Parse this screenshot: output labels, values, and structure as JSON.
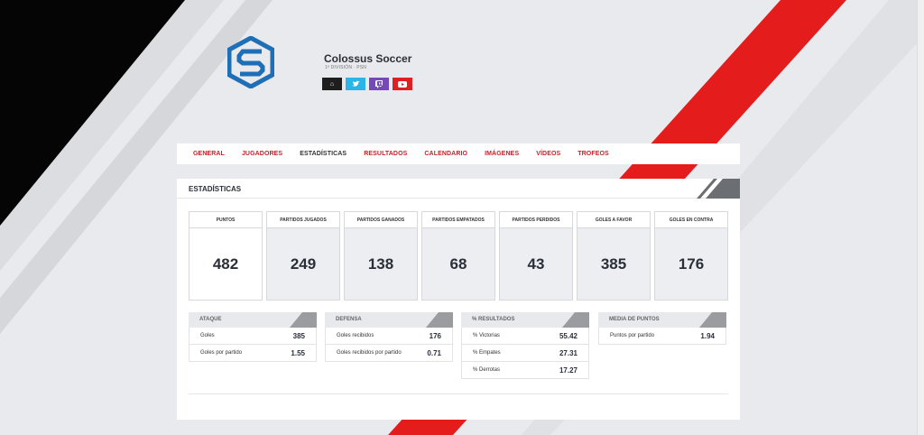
{
  "team": {
    "name": "Colossus Soccer",
    "subtitle": "1ª DIVISIÓN · PSN"
  },
  "social": {
    "home": "home-icon",
    "twitter": "twitter-icon",
    "twitch": "twitch-icon",
    "youtube": "youtube-icon"
  },
  "nav": {
    "items": [
      "GENERAL",
      "JUGADORES",
      "ESTADÍSTICAS",
      "RESULTADOS",
      "CALENDARIO",
      "IMÁGENES",
      "VÍDEOS",
      "TROFEOS"
    ],
    "active": "ESTADÍSTICAS"
  },
  "panel": {
    "title": "ESTADÍSTICAS"
  },
  "stats": [
    {
      "label": "PUNTOS",
      "value": "482"
    },
    {
      "label": "PARTIDOS JUGADOS",
      "value": "249"
    },
    {
      "label": "PARTIDOS GANADOS",
      "value": "138"
    },
    {
      "label": "PARTIDOS EMPATADOS",
      "value": "68"
    },
    {
      "label": "PARTIDOS PERDIDOS",
      "value": "43"
    },
    {
      "label": "GOLES A FAVOR",
      "value": "385"
    },
    {
      "label": "GOLES EN CONTRA",
      "value": "176"
    }
  ],
  "ataque": {
    "title": "ATAQUE",
    "rows": [
      {
        "label": "Goles",
        "value": "385"
      },
      {
        "label": "Goles por partido",
        "value": "1.55"
      }
    ]
  },
  "defensa": {
    "title": "DEFENSA",
    "rows": [
      {
        "label": "Goles recibidos",
        "value": "176"
      },
      {
        "label": "Goles recibidos por partido",
        "value": "0.71"
      }
    ]
  },
  "resultados": {
    "title": "% RESULTADOS",
    "rows": [
      {
        "label": "% Victorias",
        "value": "55.42"
      },
      {
        "label": "% Empates",
        "value": "27.31"
      },
      {
        "label": "% Derrotas",
        "value": "17.27"
      }
    ]
  },
  "media": {
    "title": "MEDIA DE PUNTOS",
    "rows": [
      {
        "label": "Puntos por partido",
        "value": "1.94"
      }
    ]
  },
  "colors": {
    "accent": "#c8202a",
    "logo": "#1e6fb5",
    "text": "#2b2f38"
  }
}
